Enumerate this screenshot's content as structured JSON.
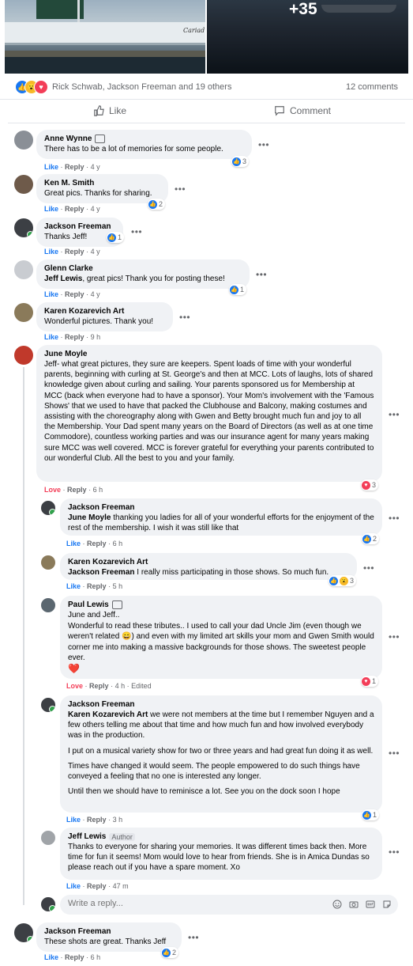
{
  "photos": {
    "boat_name": "Cariad",
    "more_count": "+35"
  },
  "reactions": {
    "names": "Rick Schwab, Jackson Freeman and 19 others",
    "comments": "12 comments"
  },
  "actions": {
    "like": "Like",
    "comment": "Comment"
  },
  "labels": {
    "like": "Like",
    "reply": "Reply",
    "love": "Love",
    "edited": "Edited",
    "author_badge": "Author",
    "dot": "·"
  },
  "comments": [
    {
      "author": "Anne Wynne",
      "text": "There has to be a lot of memories for some people.",
      "time": "4 y",
      "reaction_count": "3"
    },
    {
      "author": "Ken M. Smith",
      "text": "Great pics. Thanks for sharing.",
      "time": "4 y",
      "reaction_count": "2"
    },
    {
      "author": "Jackson Freeman",
      "text": "Thanks Jeff!",
      "time": "4 y",
      "reaction_count": "1"
    },
    {
      "author": "Glenn Clarke",
      "tag": "Jeff Lewis",
      "text": ", great pics! Thank you for posting these!",
      "time": "4 y",
      "reaction_count": "1"
    },
    {
      "author": "Karen Kozarevich Art",
      "text": "Wonderful pictures. Thank you!",
      "time": "9 h"
    },
    {
      "author": "June Moyle",
      "text": "Jeff- what great pictures, they sure are keepers. Spent loads of time with your wonderful parents, beginning with curling at St. George's and then at MCC. Lots of laughs, lots of shared knowledge given about curling and sailing. Your parents sponsored us for Membership at MCC (back when everyone had to have a sponsor). Your Mom's involvement with the 'Famous Shows' that we used to have that packed the Clubhouse and Balcony, making costumes and assisting with the choreography along with Gwen and Betty brought much fun and joy to all the Membership. Your Dad spent many years on the Board of Directors (as well as at one time Commodore), countless working parties and was our insurance agent for many years making sure MCC was well covered. MCC is forever grateful for everything your parents contributed to our wonderful Club. All the best to you and your family.",
      "time": "6 h",
      "reaction_count": "3"
    },
    {
      "author": "Jackson Freeman",
      "tag": "June Moyle",
      "text": " thanking you ladies for all of your wonderful efforts for the enjoyment of the rest of the membership. I wish it was still like that",
      "time": "6 h",
      "reaction_count": "2"
    },
    {
      "author": "Karen Kozarevich Art",
      "tag": "Jackson Freeman",
      "text": " I really miss participating in those shows. So much fun.",
      "time": "5 h",
      "reaction_count": "3"
    },
    {
      "author": "Paul Lewis",
      "text1": "June and Jeff..",
      "text2": "Wonderful to read these tributes.. I used to call your dad Uncle Jim (even though we weren't related 😄) and even with my limited art skills your mom and Gwen Smith would corner me into making a massive backgrounds for those shows. The sweetest people ever.",
      "emoji": "❤️",
      "time": "4 h",
      "reaction_count": "1"
    },
    {
      "author": "Jackson Freeman",
      "tag": "Karen Kozarevich Art",
      "text": " we were not members at the time but I remember Nguyen and a few others telling me about that time and how much fun and how involved everybody was in the production.",
      "p2": "I put on a musical variety show for two or three years and had great fun doing it as well.",
      "p3": "Times have changed it would seem. The people empowered to do such things have conveyed a feeling that no one is interested any longer.",
      "p4": "Until then we should have to reminisce a lot. See you on the dock soon I hope",
      "time": "3 h",
      "reaction_count": "1"
    },
    {
      "author": "Jeff Lewis",
      "text": "Thanks to everyone for sharing your memories. It was different times back then. More time for fun it seems! Mom would love to hear from friends. She is in Amica Dundas so please reach out if you have a spare moment. Xo",
      "time": "47 m"
    },
    {
      "author": "Jackson Freeman",
      "text": "These shots are great. Thanks Jeff",
      "time": "6 h",
      "reaction_count": "2"
    }
  ],
  "reply_box": {
    "placeholder": "Write a reply..."
  }
}
